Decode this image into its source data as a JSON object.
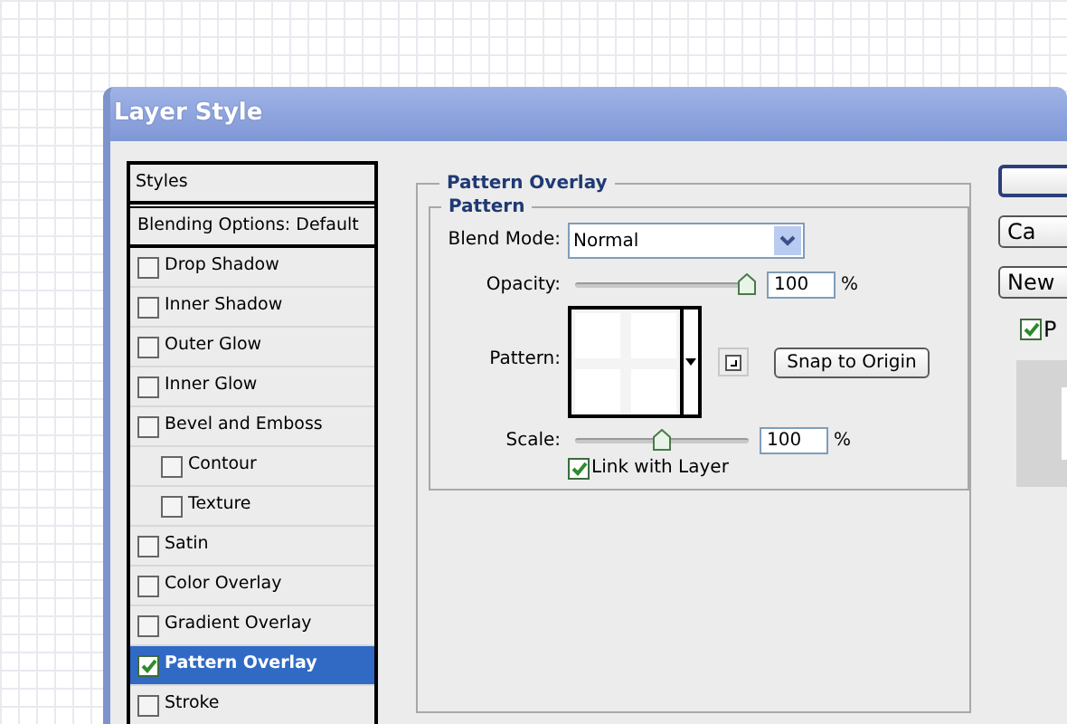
{
  "window": {
    "title": "Layer Style"
  },
  "styles_list": {
    "header": "Styles",
    "items": [
      {
        "kind": "plain",
        "label": "Blending Options: Default",
        "selected": false
      },
      {
        "kind": "check",
        "label": "Drop Shadow",
        "checked": false,
        "selected": false
      },
      {
        "kind": "check",
        "label": "Inner Shadow",
        "checked": false,
        "selected": false
      },
      {
        "kind": "check",
        "label": "Outer Glow",
        "checked": false,
        "selected": false
      },
      {
        "kind": "check",
        "label": "Inner Glow",
        "checked": false,
        "selected": false
      },
      {
        "kind": "check",
        "label": "Bevel and Emboss",
        "checked": false,
        "selected": false,
        "children": [
          {
            "kind": "check",
            "label": "Contour",
            "checked": false,
            "selected": false
          },
          {
            "kind": "check",
            "label": "Texture",
            "checked": false,
            "selected": false
          }
        ]
      },
      {
        "kind": "check",
        "label": "Satin",
        "checked": false,
        "selected": false
      },
      {
        "kind": "check",
        "label": "Color Overlay",
        "checked": false,
        "selected": false
      },
      {
        "kind": "check",
        "label": "Gradient Overlay",
        "checked": false,
        "selected": false
      },
      {
        "kind": "check",
        "label": "Pattern Overlay",
        "checked": true,
        "selected": true
      },
      {
        "kind": "check",
        "label": "Stroke",
        "checked": false,
        "selected": false
      }
    ]
  },
  "panel": {
    "title": "Pattern Overlay",
    "group_title": "Pattern",
    "blend_mode": {
      "label": "Blend Mode:",
      "value": "Normal"
    },
    "opacity": {
      "label": "Opacity:",
      "level": 1,
      "value": "100",
      "unit": "%"
    },
    "pattern": {
      "label": "Pattern:"
    },
    "snap_button": "Snap to Origin",
    "scale": {
      "label": "Scale:",
      "level": 0.5,
      "value": "100",
      "unit": "%"
    },
    "link_with_layer": {
      "label": "Link with Layer",
      "checked": true
    }
  },
  "side_buttons": [
    {
      "kind": "default"
    },
    {
      "kind": "plain",
      "label": "Ca"
    },
    {
      "kind": "plain",
      "label": "New"
    }
  ],
  "preview_checkbox": {
    "label": "P",
    "checked": true
  }
}
